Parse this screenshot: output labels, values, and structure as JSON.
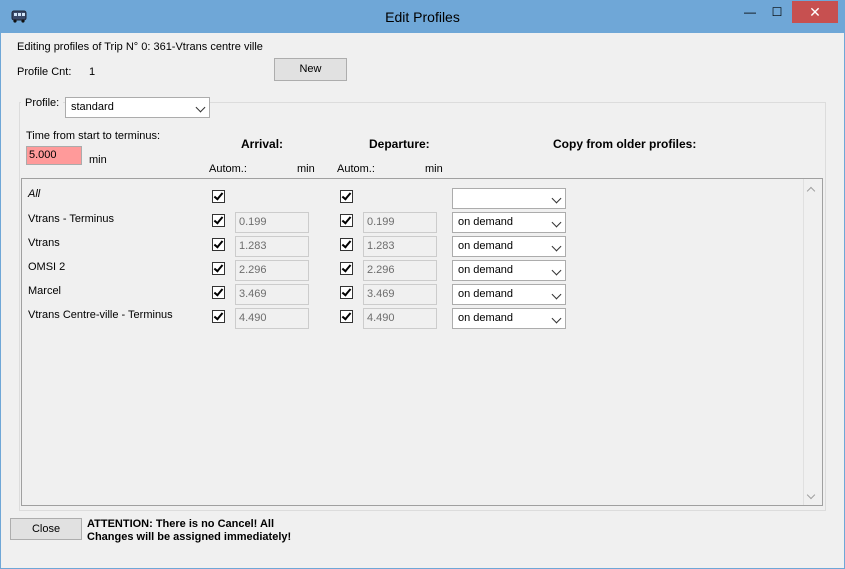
{
  "window": {
    "title": "Edit Profiles",
    "controls": {
      "minimize": "—",
      "maximize": "☐",
      "close": "✕"
    }
  },
  "header": {
    "editing_label": "Editing profiles of Trip N° 0: 361-Vtrans centre ville",
    "profile_cnt_label": "Profile Cnt:",
    "profile_cnt_value": "1",
    "new_button": "New"
  },
  "profile": {
    "label": "Profile:",
    "selected": "standard"
  },
  "timing": {
    "time_label": "Time from start to terminus:",
    "time_value": "5.000",
    "time_unit": "min",
    "arrival_label": "Arrival:",
    "departure_label": "Departure:",
    "copy_label": "Copy from older profiles:",
    "arrival_autom": "Autom.:",
    "arrival_unit": "min",
    "departure_autom": "Autom.:",
    "departure_unit": "min"
  },
  "rows": [
    {
      "name": "All",
      "arrival_checked": true,
      "arrival_value": "",
      "departure_checked": true,
      "departure_value": "",
      "copy": ""
    },
    {
      "name": "Vtrans - Terminus",
      "arrival_checked": true,
      "arrival_value": "0.199",
      "departure_checked": true,
      "departure_value": "0.199",
      "copy": "on demand"
    },
    {
      "name": "Vtrans",
      "arrival_checked": true,
      "arrival_value": "1.283",
      "departure_checked": true,
      "departure_value": "1.283",
      "copy": "on demand"
    },
    {
      "name": "OMSI 2",
      "arrival_checked": true,
      "arrival_value": "2.296",
      "departure_checked": true,
      "departure_value": "2.296",
      "copy": "on demand"
    },
    {
      "name": "Marcel",
      "arrival_checked": true,
      "arrival_value": "3.469",
      "departure_checked": true,
      "departure_value": "3.469",
      "copy": "on demand"
    },
    {
      "name": "Vtrans Centre-ville - Terminus",
      "arrival_checked": true,
      "arrival_value": "4.490",
      "departure_checked": true,
      "departure_value": "4.490",
      "copy": "on demand"
    }
  ],
  "footer": {
    "close_button": "Close",
    "attention_line1": "ATTENTION: There is no Cancel! All",
    "attention_line2": "Changes will be assigned immediately!"
  }
}
